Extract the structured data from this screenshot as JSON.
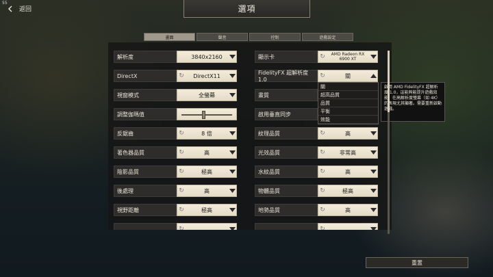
{
  "fps": "55",
  "back_label": "返回",
  "title": "選項",
  "tabs": [
    {
      "label": "畫面",
      "active": true
    },
    {
      "label": "聲音",
      "active": false
    },
    {
      "label": "控制",
      "active": false
    },
    {
      "label": "遊戲設定",
      "active": false
    }
  ],
  "left_settings": [
    {
      "label": "解析度",
      "type": "dropdown",
      "value": "3840x2160",
      "reset": false
    },
    {
      "label": "DirectX",
      "type": "dropdown",
      "value": "DirectX11",
      "reset": true
    },
    {
      "label": "視窗模式",
      "type": "dropdown",
      "value": "全螢幕",
      "reset": false
    },
    {
      "label": "調整伽瑪值",
      "type": "slider",
      "value": 0.42
    },
    {
      "label": "反鋸齒",
      "type": "dropdown",
      "value": "8 倍",
      "reset": true
    },
    {
      "label": "著色器品質",
      "type": "dropdown",
      "value": "高",
      "reset": true
    },
    {
      "label": "陰影品質",
      "type": "dropdown",
      "value": "極高",
      "reset": true
    },
    {
      "label": "後處理",
      "type": "dropdown",
      "value": "高",
      "reset": true
    },
    {
      "label": "視野距離",
      "type": "dropdown",
      "value": "極高",
      "reset": true
    },
    {
      "label": "",
      "type": "dropdown",
      "value": "",
      "reset": true
    }
  ],
  "right_settings": [
    {
      "label": "顯示卡",
      "type": "dropdown",
      "value": "AMD Radeon RX 6900 XT",
      "small": true,
      "reset": true
    },
    {
      "label": "FidelityFX 超解析度 1.0",
      "type": "dropdown",
      "value": "關",
      "reset": true,
      "open": true
    },
    {
      "label": "畫質",
      "type": "none",
      "value": ""
    },
    {
      "label": "啟用垂直同步",
      "type": "none",
      "value": ""
    },
    {
      "label": "紋理品質",
      "type": "dropdown",
      "value": "高",
      "reset": true
    },
    {
      "label": "光效品質",
      "type": "dropdown",
      "value": "非常高",
      "reset": true
    },
    {
      "label": "水紋品質",
      "type": "dropdown",
      "value": "高",
      "reset": true
    },
    {
      "label": "物體品質",
      "type": "dropdown",
      "value": "極高",
      "reset": true
    },
    {
      "label": "地勢品質",
      "type": "dropdown",
      "value": "高",
      "reset": true
    },
    {
      "label": "",
      "type": "dropdown",
      "value": "",
      "reset": true
    }
  ],
  "dropdown_options": [
    "關",
    "超高品質",
    "品質",
    "平衡",
    "效能"
  ],
  "tooltip": "啟用 AMD FidelityFX 超解析度 1.0，這能夠能提升遊戲效能，在高解析度螢幕（如 4K）的表現尤其顯著。需要重新啟動遊戲。",
  "reset_button": "重置",
  "scroll_position": 0.0
}
